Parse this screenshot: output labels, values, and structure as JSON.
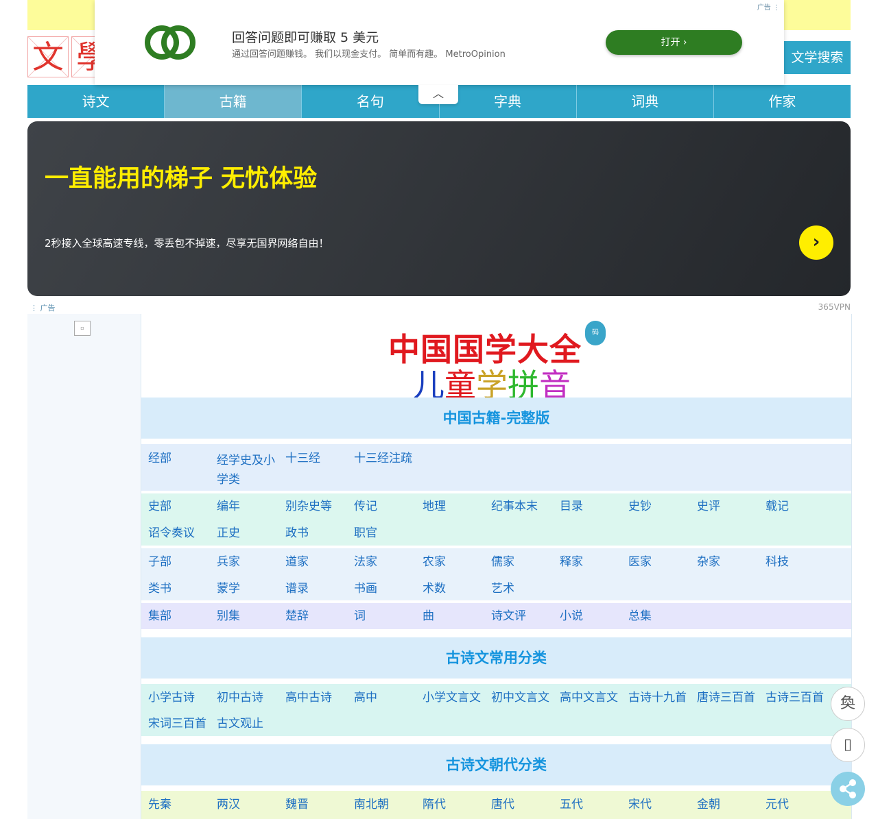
{
  "header": {
    "logo_chars": [
      "文",
      "學"
    ],
    "search_label": "文学搜索"
  },
  "nav": {
    "items": [
      "诗文",
      "古籍",
      "名句",
      "字典",
      "词典",
      "作家"
    ],
    "active": "古籍"
  },
  "top_ad": {
    "tag": "广告 ⋮",
    "title": "回答问题即可赚取 5 美元",
    "subtitle": "通过回答问题赚钱。 我们以现金支付。 简单而有趣。 MetroOpinion",
    "open_label": "打开  ›",
    "collapse_glyph": "︿",
    "ring_color": "#2e7d22"
  },
  "banner_ad": {
    "title": "一直能用的梯子 无忧体验",
    "subtitle": "2秒接入全球高速专线，零丢包不掉速，尽享无国界网络自由！",
    "arrow": "›",
    "foot_left": "⋮ 广告",
    "foot_right": "365VPN"
  },
  "left": {
    "broken_image": "▫"
  },
  "main_logo": {
    "line1": "中国国学大全",
    "line2": [
      "儿",
      "童",
      "学",
      "拼",
      "音"
    ],
    "line2_colors": [
      "#1a3fbf",
      "#e0191f",
      "#c9a227",
      "#2eb82e",
      "#c22fc2"
    ],
    "badge": "码"
  },
  "sections": [
    {
      "title": "中国古籍-完整版"
    },
    {
      "title": "古诗文常用分类"
    },
    {
      "title": "古诗文朝代分类"
    }
  ],
  "gj_rows": [
    {
      "items": [
        "经部",
        "经学史及小学类",
        "十三经",
        "十三经注疏"
      ]
    },
    {
      "items": [
        "史部",
        "编年",
        "别杂史等",
        "传记",
        "地理",
        "纪事本末",
        "目录",
        "史钞",
        "史评",
        "载记",
        "诏令奏议",
        "正史",
        "政书",
        "职官"
      ]
    },
    {
      "items": [
        "子部",
        "兵家",
        "道家",
        "法家",
        "农家",
        "儒家",
        "释家",
        "医家",
        "杂家",
        "科技",
        "类书",
        "蒙学",
        "谱录",
        "书画",
        "术数",
        "艺术"
      ]
    },
    {
      "items": [
        "集部",
        "别集",
        "楚辞",
        "词",
        "曲",
        "诗文评",
        "小说",
        "总集"
      ]
    }
  ],
  "category_row": {
    "items": [
      "小学古诗",
      "初中古诗",
      "高中古诗",
      "高中",
      "小学文言文",
      "初中文言文",
      "高中文言文",
      "古诗十九首",
      "唐诗三百首",
      "古诗三百首",
      "宋词三百首",
      "古文观止"
    ]
  },
  "dynasty_row": {
    "items": [
      "先秦",
      "两汉",
      "魏晋",
      "南北朝",
      "隋代",
      "唐代",
      "五代",
      "宋代",
      "金朝",
      "元代"
    ]
  },
  "floating": {
    "switch_glyph": "奐",
    "qr_glyph": "▯",
    "share_glyph": "⋖"
  }
}
